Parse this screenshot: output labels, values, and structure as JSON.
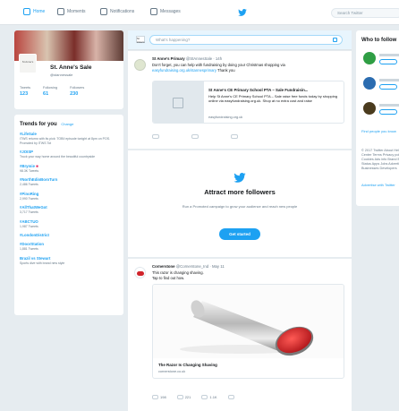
{
  "nav": {
    "items": [
      {
        "label": "Home"
      },
      {
        "label": "Moments"
      },
      {
        "label": "Notifications"
      },
      {
        "label": "Messages"
      }
    ],
    "search_placeholder": "Search Twitter",
    "brand_color": "#1da1f2"
  },
  "profile": {
    "name": "St. Anne's Sale",
    "handle": "@stannessale",
    "stats": [
      {
        "label": "Tweets",
        "value": "123"
      },
      {
        "label": "Following",
        "value": "61"
      },
      {
        "label": "Followers",
        "value": "230"
      }
    ]
  },
  "trends": {
    "title": "Trends for you",
    "change": "Change",
    "items": [
      {
        "name": "#LifeSale",
        "sub": "ITWS returns with its pick: TOBII episode tonight at 8pm on POS. Promoted by ITWS Tot"
      },
      {
        "name": "#JOISP",
        "sub": "Truck your way home around the beautiful countryside"
      },
      {
        "name": "#Brymie",
        "sub": "98.3K Tweets"
      },
      {
        "name": "#NorthEdinBoroTurn",
        "sub": "2,486 Tweets"
      },
      {
        "name": "#PinoRing",
        "sub": "2,990 Tweets"
      },
      {
        "name": "#AllThatWeGot",
        "sub": "3,717 Tweets"
      },
      {
        "name": "#ABCTUO",
        "sub": "1,987 Tweets"
      },
      {
        "name": "#LondonDistrict",
        "sub": ""
      },
      {
        "name": "#DoorStation",
        "sub": "1,881 Tweets"
      },
      {
        "name": "Brazil vs Stewart",
        "sub": "Sports dive with brand new style"
      }
    ]
  },
  "compose": {
    "placeholder": "What's happening?",
    "avatar_text": "St Anne's"
  },
  "tweet1": {
    "name": "St Anne's Primary",
    "meta": "@StAnnesSale · 14h",
    "text": "Don't forget, you can help with fundraising by doing your Christmas shopping via",
    "link": "easyfundraising.org.uk/stannesprimary",
    "text_after": " Thank you",
    "card_title": "St Anne's CE Primary School PTA – Sale Fundraisin...",
    "card_desc": "Help St Anne's CE Primary School PTA – Sale raise free funds today by shopping online via easyfundraising.org.uk. Shop at no extra cost and raise",
    "card_domain": "easyfundraising.org.uk"
  },
  "attract": {
    "title": "Attract more followers",
    "desc": "Run a Promoted campaign to grow your audience and reach new people",
    "button": "Get started"
  },
  "tweet2": {
    "name": "Cornerstone",
    "meta": "@Cornerstone_Ind · May 11",
    "text_line1": "This razor is changing shaving.",
    "text_line2": "Tap to find out how.",
    "card_title": "The Razor Is Changing Shaving",
    "card_domain": "cornerstone.co.uk",
    "stats": {
      "replies": "198",
      "retweets": "221",
      "likes": "1.1K"
    }
  },
  "who_to_follow": {
    "title": "Who to follow",
    "find_friends": "Find people you know",
    "footer": "© 2017 Twitter About Help Center Terms Privacy policy Cookies Ads info Brand Blog Status Apps Jobs Advertise Businesses Developers",
    "ads": "Advertise with Twitter"
  }
}
